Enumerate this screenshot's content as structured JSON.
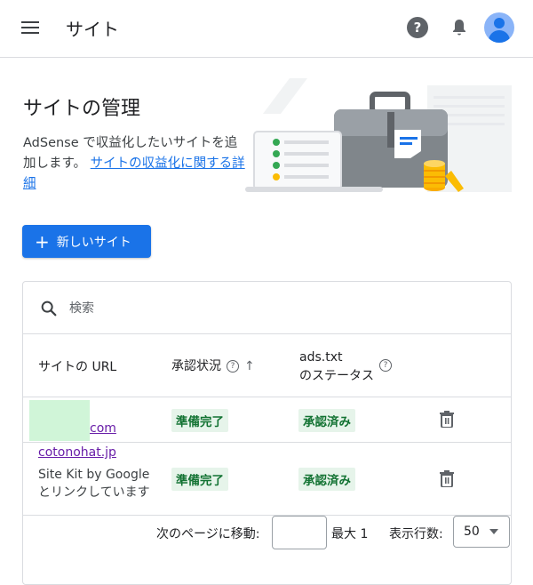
{
  "header": {
    "title": "サイト",
    "icons": [
      "menu-icon",
      "help-icon",
      "bell-icon",
      "avatar"
    ]
  },
  "hero": {
    "title": "サイトの管理",
    "desc_prefix": "AdSense で収益化したいサイトを追加します。",
    "desc_link": "サイトの収益化に関する詳細"
  },
  "new_site_button": "新しいサイト",
  "search": {
    "placeholder": "検索",
    "value": ""
  },
  "table": {
    "columns": {
      "site_url": "サイトの URL",
      "approval": "承認状況",
      "ads_txt_line1": "ads.txt",
      "ads_txt_line2": "のステータス"
    },
    "rows": [
      {
        "site": "com",
        "site_note": "",
        "approval": "準備完了",
        "ads_txt": "承認済み"
      },
      {
        "site": "cotonohat.jp",
        "site_note": "Site Kit by Google とリンクしています",
        "approval": "準備完了",
        "ads_txt": "承認済み"
      }
    ]
  },
  "pager": {
    "goto_label": "次のページに移動:",
    "goto_value": "",
    "max_label": "最大 1",
    "rows_label": "表示行数:",
    "rows_value": "50"
  },
  "colors": {
    "accent": "#1a73e8",
    "chip_bg": "#e6f4ea",
    "chip_text": "#137333",
    "visited_link": "#681da8"
  }
}
